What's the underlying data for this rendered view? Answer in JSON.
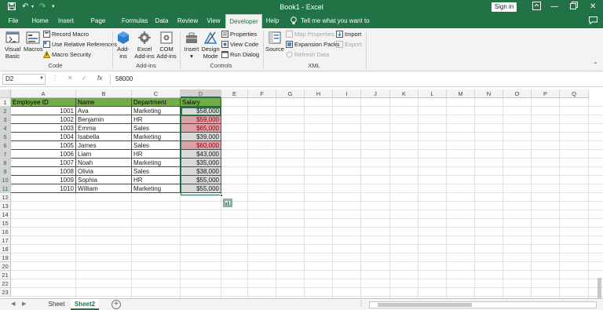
{
  "titlebar": {
    "title": "Book1  -  Excel",
    "signin_label": "Sign in",
    "save_icon": "save-icon",
    "undo_icon": "undo-icon",
    "redo_icon": "redo-icon"
  },
  "ribbon_tabs": [
    {
      "label": "File"
    },
    {
      "label": "Home"
    },
    {
      "label": "Insert"
    },
    {
      "label": "Page Layout"
    },
    {
      "label": "Formulas"
    },
    {
      "label": "Data"
    },
    {
      "label": "Review"
    },
    {
      "label": "View"
    },
    {
      "label": "Developer"
    },
    {
      "label": "Help"
    }
  ],
  "tell_me": "Tell me what you want to do",
  "ribbon": {
    "code": {
      "group_label": "Code",
      "visual_basic": [
        "Visual",
        "Basic"
      ],
      "macros": "Macros",
      "record_macro": "Record Macro",
      "use_relative": "Use Relative References",
      "macro_security": "Macro Security"
    },
    "addins": {
      "group_label": "Add-ins",
      "addins": [
        "Add-",
        "ins"
      ],
      "excel_addins": [
        "Excel",
        "Add-ins"
      ],
      "com_addins": [
        "COM",
        "Add-ins"
      ]
    },
    "controls": {
      "group_label": "Controls",
      "insert": "Insert",
      "design_mode": [
        "Design",
        "Mode"
      ],
      "properties": "Properties",
      "view_code": "View Code",
      "run_dialog": "Run Dialog"
    },
    "xml": {
      "group_label": "XML",
      "source": "Source",
      "map_properties": "Map Properties",
      "expansion_packs": "Expansion Packs",
      "refresh_data": "Refresh Data",
      "import": "Import",
      "export": "Export"
    }
  },
  "formula_bar": {
    "name_box": "D2",
    "cancel": "✕",
    "enter": "✓",
    "fx": "fx",
    "value": "58000"
  },
  "columns": [
    "A",
    "B",
    "C",
    "D",
    "E",
    "F",
    "G",
    "H",
    "I",
    "J",
    "K",
    "L",
    "M",
    "N",
    "O",
    "P",
    "Q"
  ],
  "rows": [
    "1",
    "2",
    "3",
    "4",
    "5",
    "6",
    "7",
    "8",
    "9",
    "10",
    "11",
    "12",
    "13",
    "14",
    "15",
    "16",
    "17",
    "18",
    "19",
    "20",
    "21",
    "22",
    "23"
  ],
  "table": {
    "headers": [
      "Employee ID",
      "Name",
      "Department",
      "Salary"
    ],
    "rows": [
      [
        "1001",
        "Ava",
        "Marketing",
        "$58,000"
      ],
      [
        "1002",
        "Benjamin",
        "HR",
        "$59,000"
      ],
      [
        "1003",
        "Emma",
        "Sales",
        "$65,000"
      ],
      [
        "1004",
        "Isabella",
        "Marketing",
        "$39,000"
      ],
      [
        "1005",
        "James",
        "Sales",
        "$60,000"
      ],
      [
        "1006",
        "Liam",
        "HR",
        "$43,000"
      ],
      [
        "1007",
        "Noah",
        "Marketing",
        "$35,000"
      ],
      [
        "1008",
        "Olivia",
        "Sales",
        "$38,000"
      ],
      [
        "1009",
        "Sophia",
        "HR",
        "$55,000"
      ],
      [
        "1010",
        "William",
        "Marketing",
        "$55,000"
      ]
    ],
    "highlight_color": "#d9a2a8",
    "header_color": "#70ad47"
  },
  "sheets": [
    {
      "label": "Sheet"
    },
    {
      "label": "Sheet2"
    }
  ],
  "colors": {
    "brand": "#217346",
    "ribbon_bg": "#f3f3f3"
  }
}
